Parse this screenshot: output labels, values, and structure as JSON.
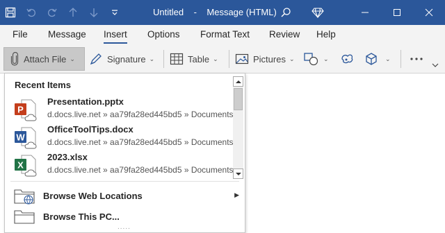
{
  "window": {
    "title_doc": "Untitled",
    "title_sep": "-",
    "title_app": "Message (HTML)"
  },
  "quick_access": [
    "save-icon",
    "undo-icon",
    "redo-icon",
    "up-arrow-icon",
    "down-arrow-icon",
    "customize-chevron-icon"
  ],
  "titlebar_buttons": [
    "search-icon",
    "diamond-icon",
    "minimize-icon",
    "maximize-icon",
    "close-icon"
  ],
  "menu_tabs": [
    "File",
    "Message",
    "Insert",
    "Options",
    "Format Text",
    "Review",
    "Help"
  ],
  "active_tab": "Insert",
  "ribbon": {
    "attach_file": "Attach File",
    "signature": "Signature",
    "table": "Table",
    "pictures": "Pictures"
  },
  "dropdown": {
    "title": "Recent Items",
    "files": [
      {
        "name": "Presentation.pptx",
        "path": "d.docs.live.net » aa79fa28ed445bd5 » Documents",
        "type": "powerpoint",
        "letter": "P",
        "color": "#c43e1c"
      },
      {
        "name": "OfficeToolTips.docx",
        "path": "d.docs.live.net » aa79fa28ed445bd5 » Documents",
        "type": "word",
        "letter": "W",
        "color": "#2b579a"
      },
      {
        "name": "2023.xlsx",
        "path": "d.docs.live.net » aa79fa28ed445bd5 » Documents",
        "type": "excel",
        "letter": "X",
        "color": "#217346"
      }
    ],
    "actions": [
      {
        "label": "Browse Web Locations",
        "has_submenu": true
      },
      {
        "label": "Browse This PC...",
        "has_submenu": false
      }
    ],
    "grip": "....."
  },
  "colors": {
    "titlebar": "#2b579a",
    "ribbon_bg": "#f3f3f3",
    "accent": "#2b579a"
  }
}
